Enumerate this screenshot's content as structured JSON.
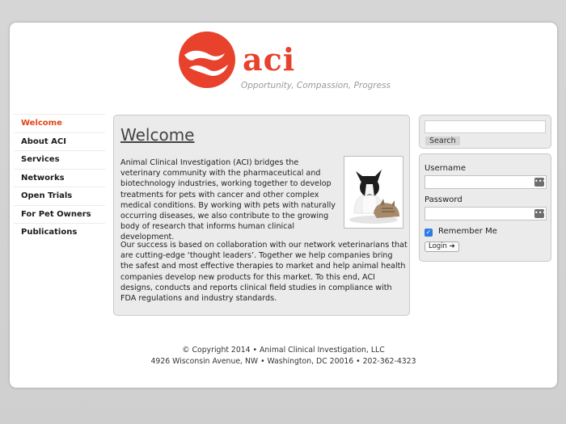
{
  "logo": {
    "text": "aci",
    "tagline": "Opportunity, Compassion, Progress",
    "color": "#e8412c"
  },
  "nav": {
    "items": [
      {
        "label": "Welcome",
        "active": true
      },
      {
        "label": "About ACI"
      },
      {
        "label": "Services"
      },
      {
        "label": "Networks"
      },
      {
        "label": "Open Trials"
      },
      {
        "label": "For Pet Owners"
      },
      {
        "label": "Publications"
      }
    ],
    "active_color": "#e04418"
  },
  "main": {
    "title": "Welcome",
    "paragraph1": "Animal Clinical Investigation (ACI) bridges the veterinary community with the pharmaceutical and biotechnology industries, working together to develop treatments for pets with cancer and other complex medical conditions. By working with pets with naturally occurring diseases, we also contribute to the growing body of research that informs human clinical development.",
    "paragraph2": "Our success is based on collaboration with our network veterinarians that are cutting-edge ‘thought leaders’. Together we help companies bring the safest and most effective therapies to market and help animal health companies develop new products for this market. To this end, ACI designs, conducts and reports clinical field studies in compliance with FDA regulations and industry standards."
  },
  "search": {
    "value": "",
    "button_label": "Search"
  },
  "login": {
    "username_label": "Username",
    "username_value": "",
    "password_label": "Password",
    "password_value": "",
    "remember_label": "Remember Me",
    "remember_checked": true,
    "button_label": "Login ➔"
  },
  "footer": {
    "line1": "© Copyright 2014 • Animal Clinical Investigation, LLC",
    "line2": "4926 Wisconsin Avenue, NW • Washington, DC 20016 • 202-362-4323"
  }
}
